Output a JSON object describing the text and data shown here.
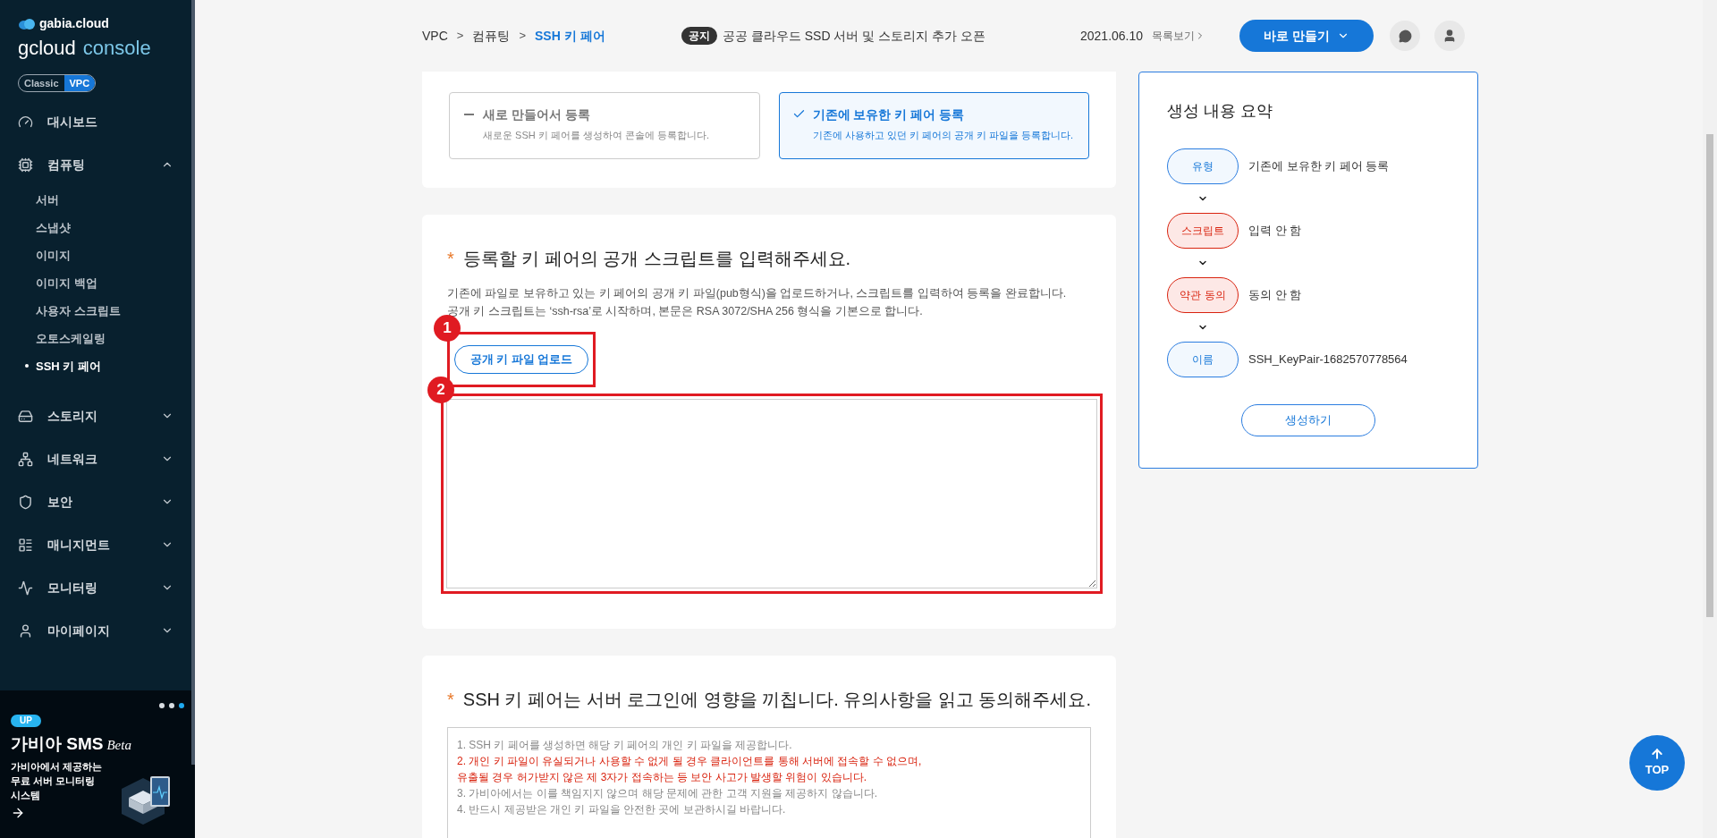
{
  "sidebar": {
    "brand_small": "gabia.cloud",
    "brand_main": "gcloud",
    "brand_accent": "console",
    "mode_toggle": [
      {
        "label": "Classic",
        "selected": false
      },
      {
        "label": "VPC",
        "selected": true
      }
    ],
    "nav": [
      {
        "label": "대시보드"
      },
      {
        "label": "컴퓨팅",
        "expanded": true,
        "children": [
          {
            "label": "서버",
            "selected": false
          },
          {
            "label": "스냅샷",
            "selected": false
          },
          {
            "label": "이미지",
            "selected": false
          },
          {
            "label": "이미지 백업",
            "selected": false
          },
          {
            "label": "사용자 스크립트",
            "selected": false
          },
          {
            "label": "오토스케일링",
            "selected": false
          },
          {
            "label": "SSH 키 페어",
            "selected": true
          }
        ]
      },
      {
        "label": "스토리지",
        "expanded": false
      },
      {
        "label": "네트워크",
        "expanded": false
      },
      {
        "label": "보안",
        "expanded": false
      },
      {
        "label": "매니지먼트",
        "expanded": false
      },
      {
        "label": "모니터링",
        "expanded": false
      },
      {
        "label": "마이페이지",
        "expanded": false
      }
    ],
    "promo": {
      "badge": "UP",
      "title": "가비아 SMS",
      "title_suffix": "Beta",
      "lines": [
        "가비아에서 제공하는",
        "무료 서버 모니터링",
        "시스템"
      ],
      "dots": [
        {
          "selected": false
        },
        {
          "selected": false
        },
        {
          "selected": true
        }
      ]
    }
  },
  "topbar": {
    "breadcrumb": [
      {
        "label": "VPC",
        "selected": false
      },
      {
        "label": "컴퓨팅",
        "selected": false
      },
      {
        "label": "SSH 키 페어",
        "selected": true
      }
    ],
    "breadcrumb_separators": [
      ">",
      ">"
    ],
    "notice": {
      "badge": "공지",
      "text": "공공 클라우드 SSD 서버 및 스토리지 추가 오픈",
      "date": "2021.06.10",
      "more_link": "목록보기"
    },
    "create_button": "바로 만들기"
  },
  "type_options": [
    {
      "title": "새로 만들어서 등록",
      "description": "새로운 SSH 키 페어를 생성하여 콘솔에 등록합니다.",
      "selected": false
    },
    {
      "title": "기존에 보유한 키 페어 등록",
      "description": "기존에 사용하고 있던 키 페어의 공개 키 파일을 등록합니다.",
      "selected": true
    }
  ],
  "script_section": {
    "required_mark": "*",
    "title": "등록할 키 페어의 공개 스크립트를 입력해주세요.",
    "description_lines": [
      "기존에 파일로 보유하고 있는 키 페어의 공개 키 파일(pub형식)을 업로드하거나, 스크립트를 입력하여 등록을 완료합니다.",
      "공개 키 스크립트는 ‘ssh-rsa’로 시작하며, 본문은 RSA 3072/SHA 256 형식을 기본으로 합니다."
    ],
    "upload_button": "공개 키 파일 업로드",
    "annotations": [
      "1",
      "2"
    ]
  },
  "agreement_section": {
    "required_mark": "*",
    "title": "SSH 키 페어는 서버 로그인에 영향을 끼칩니다. 유의사항을 읽고 동의해주세요.",
    "terms": [
      {
        "text": "1. SSH 키 페어를 생성하면 해당 키 페어의 개인 키 파일을 제공합니다.",
        "warning": false
      },
      {
        "text": "2. 개인 키 파일이 유실되거나 사용할 수 없게 될 경우 클라이언트를 통해 서버에 접속할 수 없으며,",
        "warning": true
      },
      {
        "text": "유출될 경우 허가받지 않은 제 3자가 접속하는 등 보안 사고가 발생할 위험이 있습니다.",
        "warning": true
      },
      {
        "text": "3. 가비아에서는 이를 책임지지 않으며 해당 문제에 관한 고객 지원을 제공하지 않습니다.",
        "warning": false
      },
      {
        "text": "4. 반드시 제공받은 개인 키 파일을 안전한 곳에 보관하시길 바랍니다.",
        "warning": false
      }
    ]
  },
  "summary": {
    "title": "생성 내용 요약",
    "steps": [
      {
        "tag": "유형",
        "value": "기존에 보유한 키 페어 등록",
        "complete": true
      },
      {
        "tag": "스크립트",
        "value": "입력 안 함",
        "complete": false
      },
      {
        "tag": "약관 동의",
        "value": "동의 안 함",
        "complete": false
      },
      {
        "tag": "이름",
        "value": "SSH_KeyPair-1682570778564",
        "complete": true
      }
    ],
    "button": "생성하기"
  },
  "top_button": "TOP"
}
